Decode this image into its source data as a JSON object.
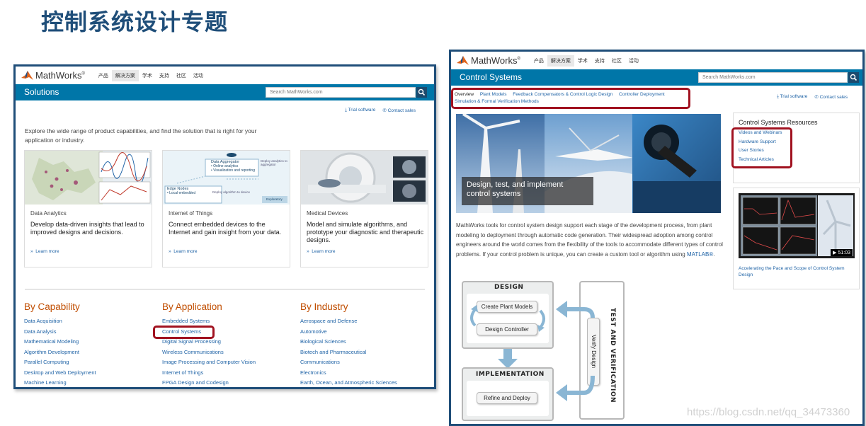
{
  "slide": {
    "title": "控制系统设计专题"
  },
  "nav": {
    "logo_text": "MathWorks",
    "logo_reg": "®",
    "items": [
      "产品",
      "解决方案",
      "学术",
      "支持",
      "社区",
      "活动"
    ],
    "active_index": 1
  },
  "left_page": {
    "section_title": "Solutions",
    "search_placeholder": "Search MathWorks.com",
    "trial": "Trial software",
    "contact": "Contact sales",
    "intro": "Explore the wide range of product capabilities, and find the solution that is right for your application or industry.",
    "cards": [
      {
        "category": "Data Analytics",
        "headline": "Develop data-driven insights that lead to improved designs and decisions.",
        "learn_more": "Learn more"
      },
      {
        "category": "Internet of Things",
        "headline": "Connect embedded devices to the Internet and gain insight from your data.",
        "learn_more": "Learn more"
      },
      {
        "category": "Medical Devices",
        "headline": "Model and simulate algorithms, and prototype your diagnostic and therapeutic designs.",
        "learn_more": "Learn more"
      }
    ],
    "iot_image_text": {
      "aggregator": "Data Aggregator",
      "online": "• Online analytics",
      "viz": "• Visualization and reporting",
      "deploy_analytics": "Deploy analytics to aggregator",
      "edge": "Edge Nodes",
      "local": "• Local embedded",
      "deploy_algo": "Deploy algorithm to device",
      "exploratory": "Exploratory"
    },
    "columns": [
      {
        "title": "By Capability",
        "links": [
          "Data Acquisition",
          "Data Analysis",
          "Mathematical Modeling",
          "Algorithm Development",
          "Parallel Computing",
          "Desktop and Web Deployment",
          "Machine Learning"
        ]
      },
      {
        "title": "By Application",
        "links": [
          "Embedded Systems",
          "Control Systems",
          "Digital Signal Processing",
          "Wireless Communications",
          "Image Processing and Computer Vision",
          "Internet of Things",
          "FPGA Design and Codesign"
        ]
      },
      {
        "title": "By Industry",
        "links": [
          "Aerospace and Defense",
          "Automotive",
          "Biological Sciences",
          "Biotech and Pharmaceutical",
          "Communications",
          "Electronics",
          "Earth, Ocean, and Atmospheric Sciences"
        ]
      }
    ]
  },
  "right_page": {
    "section_title": "Control Systems",
    "search_placeholder": "Search MathWorks.com",
    "trial": "Trial software",
    "contact": "Contact sales",
    "tabs": [
      "Overview",
      "Plant Models",
      "Feedback Compensators & Control Logic Design",
      "Controller Deployment",
      "Simulation & Formal Verification Methods"
    ],
    "hero_caption": "Design, test, and implement control systems",
    "paragraph": "MathWorks tools for control system design support each stage of the development process, from plant modeling to deployment through automatic code generation. Their widespread adoption among control engineers around the world comes from the flexibility of the tools to accommodate different types of control problems. If your control problem is unique, you can create a custom tool or algorithm using ",
    "paragraph_link": "MATLAB®",
    "paragraph_end": ".",
    "resources_title": "Control Systems Resources",
    "resources": [
      "Videos and Webinars",
      "Hardware Support",
      "User Stories",
      "Technical Articles"
    ],
    "video_duration": "51:03",
    "video_caption": "Accelerating the Pace and Scope of Control System Design",
    "diagram": {
      "design": "DESIGN",
      "create": "Create Plant Models",
      "controller": "Design Controller",
      "implementation": "IMPLEMENTATION",
      "refine": "Refine and Deploy",
      "test": "TEST AND VERIFICATION",
      "verify": "Verify Design"
    }
  },
  "watermark": "https://blog.csdn.net/qq_34473360"
}
